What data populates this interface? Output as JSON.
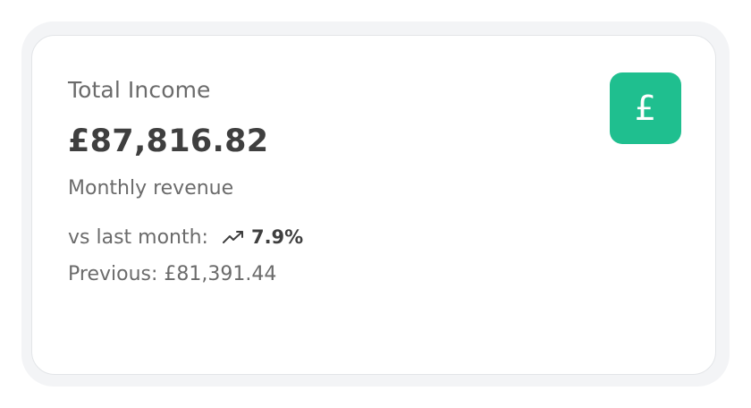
{
  "card": {
    "title": "Total Income",
    "amount": "£87,816.82",
    "subtitle": "Monthly revenue",
    "comparison_label": "vs last month:",
    "trend_value": "7.9%",
    "trend_icon": "trending-up-icon",
    "previous": "Previous: £81,391.44",
    "badge_symbol": "£",
    "badge_icon": "pound-icon",
    "accent_color": "#1fbf8f"
  }
}
